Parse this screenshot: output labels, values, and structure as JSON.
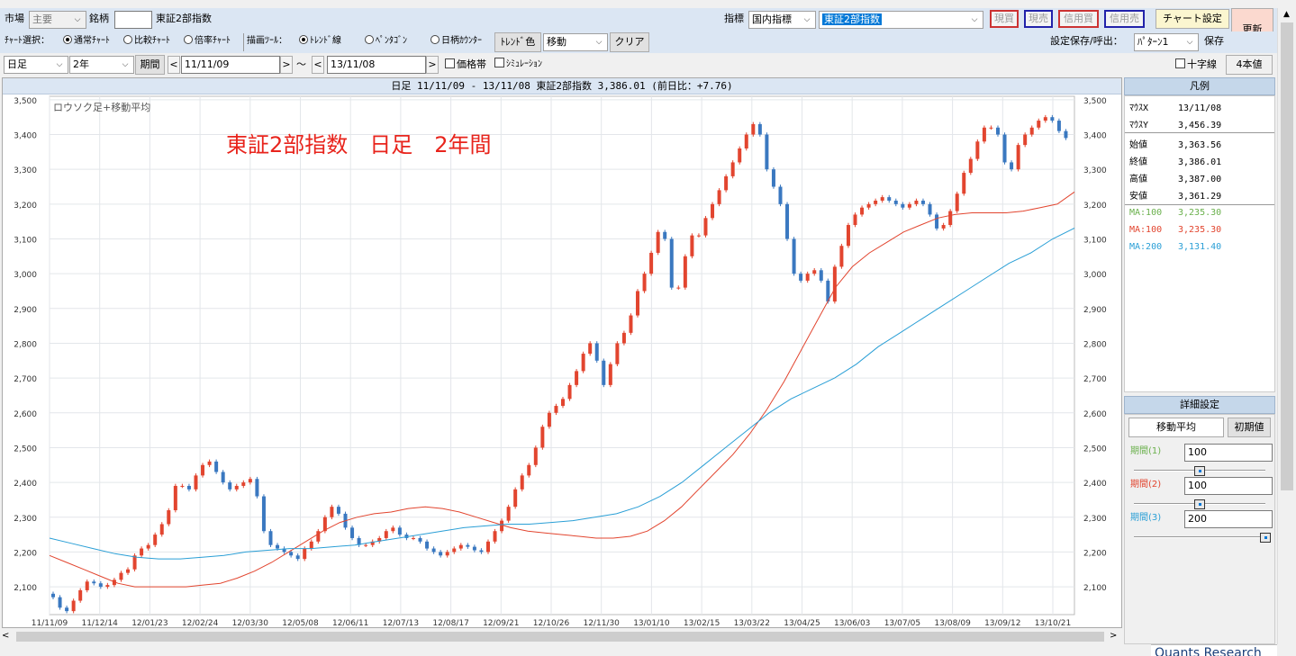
{
  "toolbar1": {
    "market_label": "市場",
    "market_value": "主要",
    "symbol_label": "銘柄",
    "symbol_value": "",
    "symbol_name": "東証2部指数",
    "indicator_label": "指標",
    "indicator_category": "国内指標",
    "indicator_value": "東証2部指数",
    "buttons": {
      "cash_buy": "現買",
      "cash_sell": "現売",
      "margin_buy": "信用買",
      "margin_sell": "信用売",
      "chart_settings": "チャート設定",
      "refresh": "更新"
    }
  },
  "toolbar2": {
    "chart_select_label": "ﾁｬｰﾄ選択：",
    "chart_types": [
      "通常ﾁｬｰﾄ",
      "比較ﾁｬｰﾄ",
      "倍率ﾁｬｰﾄ"
    ],
    "draw_tool_label": "描画ﾂｰﾙ：",
    "draw_tools": [
      "ﾄﾚﾝﾄﾞ線",
      "ﾍﾟﾝﾀｺﾞﾝ",
      "日柄ｶｳﾝﾀｰ"
    ],
    "trend_color_button": "ﾄﾚﾝﾄﾞ色",
    "move_select": "移動",
    "clear_button": "クリア",
    "save_load_label": "設定保存/呼出：",
    "pattern_select": "ﾊﾟﾀｰﾝ1",
    "save_button": "保存"
  },
  "toolbar3": {
    "period_type": "日足",
    "span": "2年",
    "period_button": "期間",
    "from_date": "11/11/09",
    "tilde": "～",
    "to_date": "13/11/08",
    "price_band_label": "価格帯",
    "simulation_label": "ｼﾐｭﾚｰｼｮﾝ",
    "crosshair_label": "十字線",
    "candles_button": "4本値"
  },
  "chart_header": "日足 11/11/09 - 13/11/08   東証2部指数   3,386.01 (前日比：+7.76)",
  "chart_data": {
    "type": "line",
    "subtitle": "ロウソク足+移動平均",
    "overlay_title": "東証2部指数　日足　2年間",
    "ylim": [
      2020,
      3510
    ],
    "yticks": [
      2100,
      2200,
      2300,
      2400,
      2500,
      2600,
      2700,
      2800,
      2900,
      3000,
      3100,
      3200,
      3300,
      3400,
      3500
    ],
    "ytick_labels": [
      "2,100",
      "2,200",
      "2,300",
      "2,400",
      "2,500",
      "2,600",
      "2,700",
      "2,800",
      "2,900",
      "3,000",
      "3,100",
      "3,200",
      "3,300",
      "3,400",
      "3,500"
    ],
    "x_labels": [
      "11/11/09",
      "11/12/14",
      "12/01/23",
      "12/02/24",
      "12/03/30",
      "12/05/08",
      "12/06/11",
      "12/07/13",
      "12/08/17",
      "12/09/21",
      "12/10/26",
      "12/11/30",
      "13/01/10",
      "13/02/15",
      "13/03/22",
      "13/04/25",
      "13/06/03",
      "13/07/05",
      "13/08/09",
      "13/09/12",
      "13/10/21"
    ],
    "series": [
      {
        "values": [
          2070,
          2040,
          2030,
          2060,
          2090,
          2115,
          2110,
          2100,
          2105,
          2120,
          2140,
          2150,
          2190,
          2210,
          2220,
          2250,
          2280,
          2320,
          2390,
          2390,
          2380,
          2420,
          2450,
          2460,
          2430,
          2400,
          2380,
          2390,
          2400,
          2410,
          2360,
          2260,
          2220,
          2210,
          2200,
          2190,
          2180,
          2210,
          2230,
          2260,
          2300,
          2330,
          2310,
          2270,
          2240,
          2220,
          2220,
          2230,
          2240,
          2260,
          2270,
          2250,
          2240,
          2240,
          2230,
          2210,
          2200,
          2190,
          2200,
          2210,
          2220,
          2215,
          2205,
          2200,
          2230,
          2260,
          2290,
          2330,
          2380,
          2420,
          2450,
          2500,
          2560,
          2600,
          2620,
          2640,
          2680,
          2720,
          2770,
          2800,
          2750,
          2680,
          2740,
          2800,
          2830,
          2880,
          2950,
          3000,
          3060,
          3120,
          3100,
          2960,
          2960,
          3050,
          3110,
          3110,
          3160,
          3200,
          3240,
          3280,
          3320,
          3360,
          3400,
          3430,
          3400,
          3300,
          3250,
          3200,
          3100,
          3000,
          2980,
          3000,
          3010,
          2980,
          2920,
          3020,
          3080,
          3140,
          3170,
          3190,
          3200,
          3210,
          3220,
          3210,
          3200,
          3190,
          3200,
          3210,
          3200,
          3170,
          3130,
          3140,
          3180,
          3230,
          3290,
          3330,
          3380,
          3420,
          3420,
          3400,
          3320,
          3300,
          3370,
          3400,
          3420,
          3440,
          3450,
          3440,
          3410,
          3390
        ]
      },
      {
        "name": "MA:100",
        "values": [
          2190,
          2170,
          2150,
          2130,
          2110,
          2100,
          2100,
          2100,
          2100,
          2105,
          2110,
          2125,
          2145,
          2170,
          2200,
          2230,
          2260,
          2285,
          2300,
          2310,
          2315,
          2325,
          2330,
          2325,
          2315,
          2300,
          2285,
          2270,
          2260,
          2255,
          2250,
          2245,
          2240,
          2240,
          2245,
          2260,
          2290,
          2330,
          2380,
          2430,
          2480,
          2540,
          2610,
          2690,
          2780,
          2870,
          2960,
          3020,
          3060,
          3090,
          3120,
          3140,
          3160,
          3170,
          3175,
          3175,
          3175,
          3180,
          3190,
          3200,
          3235
        ]
      },
      {
        "name": "MA:200",
        "values": [
          2240,
          2225,
          2210,
          2195,
          2185,
          2180,
          2180,
          2185,
          2190,
          2200,
          2205,
          2210,
          2210,
          2215,
          2220,
          2230,
          2240,
          2250,
          2260,
          2270,
          2275,
          2280,
          2280,
          2285,
          2290,
          2300,
          2310,
          2330,
          2360,
          2400,
          2450,
          2500,
          2550,
          2600,
          2640,
          2670,
          2700,
          2740,
          2790,
          2830,
          2870,
          2910,
          2950,
          2990,
          3030,
          3060,
          3100,
          3131
        ]
      }
    ]
  },
  "legend": {
    "header": "凡例",
    "mouse_x_label": "ﾏｳｽX",
    "mouse_x_value": "13/11/08",
    "mouse_y_label": "ﾏｳｽY",
    "mouse_y_value": "3,456.39",
    "rows": [
      {
        "k": "始値",
        "v": "3,363.56"
      },
      {
        "k": "終値",
        "v": "3,386.01"
      },
      {
        "k": "高値",
        "v": "3,387.00"
      },
      {
        "k": "安値",
        "v": "3,361.29"
      }
    ],
    "ma_rows": [
      {
        "k": "MA:100",
        "v": "3,235.30",
        "color": "#6ab04c"
      },
      {
        "k": "MA:100",
        "v": "3,235.30",
        "color": "#e2452f"
      },
      {
        "k": "MA:200",
        "v": "3,131.40",
        "color": "#2a9fd6"
      }
    ]
  },
  "detail": {
    "header": "詳細設定",
    "tab_label": "移動平均",
    "init_button": "初期値",
    "periods": [
      {
        "label": "期間(1)",
        "value": "100",
        "color": "#6ab04c",
        "slider_fraction": 0.5
      },
      {
        "label": "期間(2)",
        "value": "100",
        "color": "#e2452f",
        "slider_fraction": 0.5
      },
      {
        "label": "期間(3)",
        "value": "200",
        "color": "#2a9fd6",
        "slider_fraction": 1.0
      }
    ]
  },
  "footer_brand": "Quants Research",
  "colors": {
    "up": "#e2452f",
    "down": "#3a78c0",
    "ma1": "#e2452f",
    "ma2": "#2a9fd6",
    "title_red": "#e8241c"
  }
}
